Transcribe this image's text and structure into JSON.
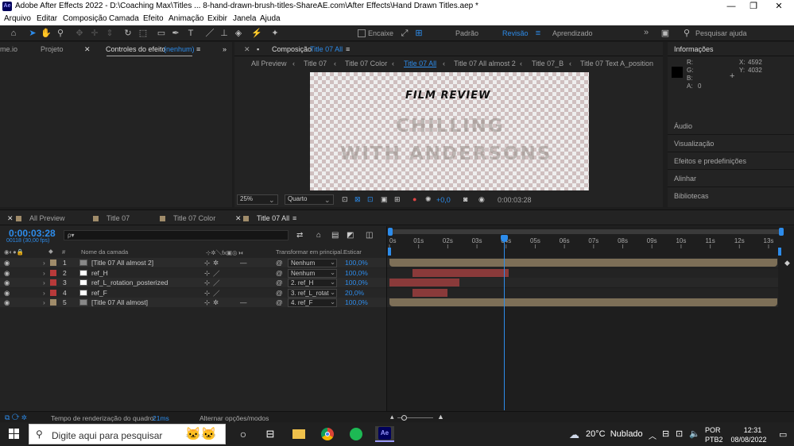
{
  "window": {
    "title": "Adobe After Effects 2022 - D:\\Coaching Max\\Titles ... 8-hand-drawn-brush-titles-ShareAE.com\\After Effects\\Hand Drawn Titles.aep *",
    "logo": "Ae",
    "min": "—",
    "max": "❐",
    "close": "✕"
  },
  "menu": [
    "Arquivo",
    "Editar",
    "Composição",
    "Camada",
    "Efeito",
    "Animação",
    "Exibir",
    "Janela",
    "Ajuda"
  ],
  "toolbar": {
    "snap_label": "Encaixe",
    "workspaces": [
      "Padrão",
      "Revisão",
      "Aprendizado"
    ],
    "search_placeholder": "Pesquisar ajuda",
    "overflow": "»"
  },
  "left_panel": {
    "tabs": [
      "me.io",
      "Projeto",
      "Controles do efeito"
    ],
    "effect_target": "(nenhum)"
  },
  "comp_panel": {
    "label": "Composição",
    "comp_name": "Title 07 All",
    "breadcrumbs": [
      "All Preview",
      "Title 07",
      "Title 07 Color",
      "Title 07 All",
      "Title 07 All almost 2",
      "Title 07_B",
      "Title 07 Text A_position"
    ],
    "canvas": {
      "line1": "FILM REVIEW",
      "line2": "CHILLING",
      "line3": "WITH ANDERSONS"
    },
    "zoom": "25%",
    "resolution": "Quarto",
    "exposure": "+0,0",
    "timecode": "0:00:03:28"
  },
  "info_panel": {
    "title": "Informações",
    "r": "R:",
    "g": "G:",
    "b": "B:",
    "a": "A:",
    "a_val": "0",
    "x": "X:",
    "x_val": "4592",
    "y": "Y:",
    "y_val": "4032",
    "panels": [
      "Áudio",
      "Visualização",
      "Efeitos e predefinições",
      "Alinhar",
      "Bibliotecas"
    ]
  },
  "timeline": {
    "tabs": [
      "All Preview",
      "Title 07",
      "Title 07 Color",
      "Title 07 All"
    ],
    "tab_colors": [
      "#a08c6a",
      "#a08c6a",
      "#a08c6a",
      "#a08c6a"
    ],
    "timecode": "0:00:03:28",
    "frames": "00118 (30,00 fps)",
    "search_placeholder": "ρ▾",
    "col_num": "#",
    "col_name": "Nome da camada",
    "col_parent": "Transformar em principal...",
    "col_stretch": "Esticar",
    "ruler": [
      "0s",
      "01s",
      "02s",
      "03s",
      "04s",
      "05s",
      "06s",
      "07s",
      "08s",
      "09s",
      "10s",
      "11s",
      "12s",
      "13s"
    ],
    "current_time_s": 3.93,
    "duration_s": 13.3,
    "layers": [
      {
        "num": "1",
        "name": "[Title 07 All almost 2]",
        "color": "#a08c6a",
        "parent": "Nenhum",
        "stretch": "100,0%",
        "bar_start": 0,
        "bar_end": 13.3,
        "bar_color": "#7d6f57",
        "is_comp": true
      },
      {
        "num": "2",
        "name": "ref_H",
        "color": "#b83a3a",
        "parent": "Nenhum",
        "stretch": "100,0%",
        "bar_start": 0.8,
        "bar_end": 4.1,
        "bar_color": "#8a3a3a",
        "is_comp": false
      },
      {
        "num": "3",
        "name": "ref_L_rotation_posterized",
        "color": "#b83a3a",
        "parent": "2. ref_H",
        "stretch": "100,0%",
        "bar_start": 0,
        "bar_end": 2.4,
        "bar_color": "#8a3a3a",
        "is_comp": false
      },
      {
        "num": "4",
        "name": "ref_F",
        "color": "#b83a3a",
        "parent": "3. ref_L_rotat",
        "stretch": "20,0%",
        "bar_start": 0.8,
        "bar_end": 2.0,
        "bar_color": "#8a3a3a",
        "is_comp": false
      },
      {
        "num": "5",
        "name": "[Title 07 All almost]",
        "color": "#a08c6a",
        "parent": "4. ref_F",
        "stretch": "100,0%",
        "bar_start": 0,
        "bar_end": 13.3,
        "bar_color": "#7d6f57",
        "is_comp": true
      }
    ],
    "render_label": "Tempo de renderização do quadro:",
    "render_time": "21ms",
    "toggle_label": "Alternar opções/modos"
  },
  "taskbar": {
    "search_placeholder": "Digite aqui para pesquisar",
    "weather": "20°C  Nublado",
    "lang1": "POR",
    "lang2": "PTB2",
    "time": "12:31",
    "date": "08/08/2022"
  }
}
